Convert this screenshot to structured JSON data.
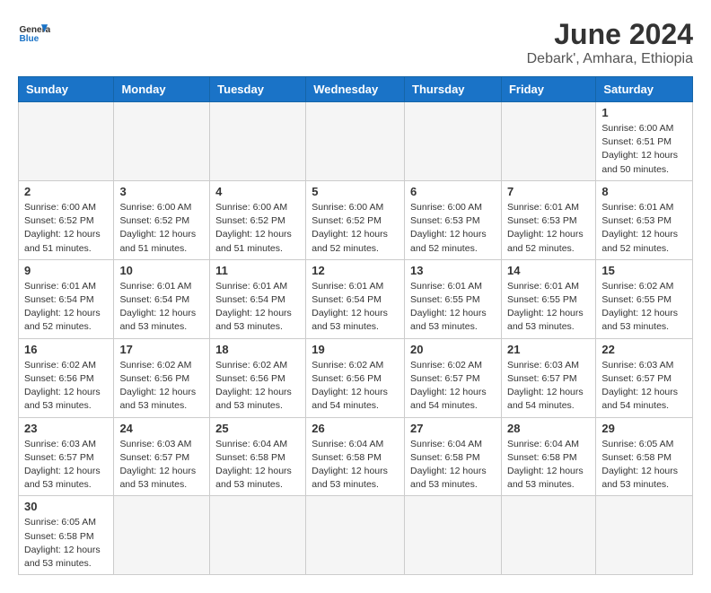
{
  "logo": {
    "general": "General",
    "blue": "Blue"
  },
  "title": "June 2024",
  "subtitle": "Debark', Amhara, Ethiopia",
  "days_of_week": [
    "Sunday",
    "Monday",
    "Tuesday",
    "Wednesday",
    "Thursday",
    "Friday",
    "Saturday"
  ],
  "weeks": [
    [
      {
        "day": "",
        "info": ""
      },
      {
        "day": "",
        "info": ""
      },
      {
        "day": "",
        "info": ""
      },
      {
        "day": "",
        "info": ""
      },
      {
        "day": "",
        "info": ""
      },
      {
        "day": "",
        "info": ""
      },
      {
        "day": "1",
        "info": "Sunrise: 6:00 AM\nSunset: 6:51 PM\nDaylight: 12 hours\nand 50 minutes."
      }
    ],
    [
      {
        "day": "2",
        "info": "Sunrise: 6:00 AM\nSunset: 6:52 PM\nDaylight: 12 hours\nand 51 minutes."
      },
      {
        "day": "3",
        "info": "Sunrise: 6:00 AM\nSunset: 6:52 PM\nDaylight: 12 hours\nand 51 minutes."
      },
      {
        "day": "4",
        "info": "Sunrise: 6:00 AM\nSunset: 6:52 PM\nDaylight: 12 hours\nand 51 minutes."
      },
      {
        "day": "5",
        "info": "Sunrise: 6:00 AM\nSunset: 6:52 PM\nDaylight: 12 hours\nand 52 minutes."
      },
      {
        "day": "6",
        "info": "Sunrise: 6:00 AM\nSunset: 6:53 PM\nDaylight: 12 hours\nand 52 minutes."
      },
      {
        "day": "7",
        "info": "Sunrise: 6:01 AM\nSunset: 6:53 PM\nDaylight: 12 hours\nand 52 minutes."
      },
      {
        "day": "8",
        "info": "Sunrise: 6:01 AM\nSunset: 6:53 PM\nDaylight: 12 hours\nand 52 minutes."
      }
    ],
    [
      {
        "day": "9",
        "info": "Sunrise: 6:01 AM\nSunset: 6:54 PM\nDaylight: 12 hours\nand 52 minutes."
      },
      {
        "day": "10",
        "info": "Sunrise: 6:01 AM\nSunset: 6:54 PM\nDaylight: 12 hours\nand 53 minutes."
      },
      {
        "day": "11",
        "info": "Sunrise: 6:01 AM\nSunset: 6:54 PM\nDaylight: 12 hours\nand 53 minutes."
      },
      {
        "day": "12",
        "info": "Sunrise: 6:01 AM\nSunset: 6:54 PM\nDaylight: 12 hours\nand 53 minutes."
      },
      {
        "day": "13",
        "info": "Sunrise: 6:01 AM\nSunset: 6:55 PM\nDaylight: 12 hours\nand 53 minutes."
      },
      {
        "day": "14",
        "info": "Sunrise: 6:01 AM\nSunset: 6:55 PM\nDaylight: 12 hours\nand 53 minutes."
      },
      {
        "day": "15",
        "info": "Sunrise: 6:02 AM\nSunset: 6:55 PM\nDaylight: 12 hours\nand 53 minutes."
      }
    ],
    [
      {
        "day": "16",
        "info": "Sunrise: 6:02 AM\nSunset: 6:56 PM\nDaylight: 12 hours\nand 53 minutes."
      },
      {
        "day": "17",
        "info": "Sunrise: 6:02 AM\nSunset: 6:56 PM\nDaylight: 12 hours\nand 53 minutes."
      },
      {
        "day": "18",
        "info": "Sunrise: 6:02 AM\nSunset: 6:56 PM\nDaylight: 12 hours\nand 53 minutes."
      },
      {
        "day": "19",
        "info": "Sunrise: 6:02 AM\nSunset: 6:56 PM\nDaylight: 12 hours\nand 54 minutes."
      },
      {
        "day": "20",
        "info": "Sunrise: 6:02 AM\nSunset: 6:57 PM\nDaylight: 12 hours\nand 54 minutes."
      },
      {
        "day": "21",
        "info": "Sunrise: 6:03 AM\nSunset: 6:57 PM\nDaylight: 12 hours\nand 54 minutes."
      },
      {
        "day": "22",
        "info": "Sunrise: 6:03 AM\nSunset: 6:57 PM\nDaylight: 12 hours\nand 54 minutes."
      }
    ],
    [
      {
        "day": "23",
        "info": "Sunrise: 6:03 AM\nSunset: 6:57 PM\nDaylight: 12 hours\nand 53 minutes."
      },
      {
        "day": "24",
        "info": "Sunrise: 6:03 AM\nSunset: 6:57 PM\nDaylight: 12 hours\nand 53 minutes."
      },
      {
        "day": "25",
        "info": "Sunrise: 6:04 AM\nSunset: 6:58 PM\nDaylight: 12 hours\nand 53 minutes."
      },
      {
        "day": "26",
        "info": "Sunrise: 6:04 AM\nSunset: 6:58 PM\nDaylight: 12 hours\nand 53 minutes."
      },
      {
        "day": "27",
        "info": "Sunrise: 6:04 AM\nSunset: 6:58 PM\nDaylight: 12 hours\nand 53 minutes."
      },
      {
        "day": "28",
        "info": "Sunrise: 6:04 AM\nSunset: 6:58 PM\nDaylight: 12 hours\nand 53 minutes."
      },
      {
        "day": "29",
        "info": "Sunrise: 6:05 AM\nSunset: 6:58 PM\nDaylight: 12 hours\nand 53 minutes."
      }
    ],
    [
      {
        "day": "30",
        "info": "Sunrise: 6:05 AM\nSunset: 6:58 PM\nDaylight: 12 hours\nand 53 minutes."
      },
      {
        "day": "",
        "info": ""
      },
      {
        "day": "",
        "info": ""
      },
      {
        "day": "",
        "info": ""
      },
      {
        "day": "",
        "info": ""
      },
      {
        "day": "",
        "info": ""
      },
      {
        "day": "",
        "info": ""
      }
    ]
  ]
}
